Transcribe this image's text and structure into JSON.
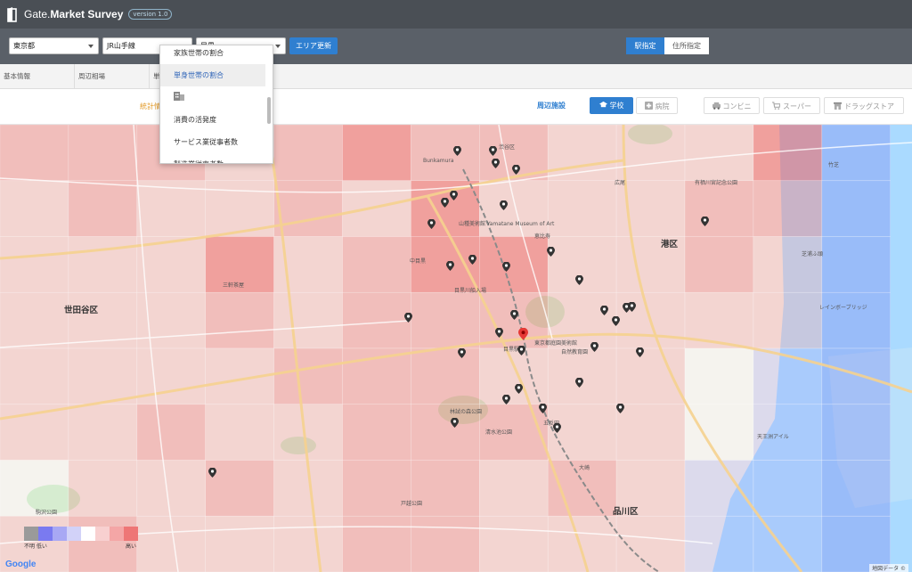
{
  "header": {
    "brand_prefix": "Gate.",
    "brand_main": "Market Survey",
    "version": "version 1.0"
  },
  "toolbar": {
    "prefecture": "東京都",
    "line": "JR山手線",
    "station": "目黒",
    "update_button": "エリア更新",
    "mode_station": "駅指定",
    "mode_address": "住所指定"
  },
  "tabs": [
    "基本情報",
    "周辺相場",
    "単"
  ],
  "filter": {
    "stats_link": "統計情",
    "facility_label": "周辺施設",
    "buttons": [
      {
        "label": "学校",
        "icon": "school-icon",
        "active": true
      },
      {
        "label": "病院",
        "icon": "hospital-icon",
        "active": false
      },
      {
        "label": "コンビニ",
        "icon": "car-icon",
        "active": false
      },
      {
        "label": "スーパー",
        "icon": "cart-icon",
        "active": false
      },
      {
        "label": "ドラッグストア",
        "icon": "store-icon",
        "active": false
      }
    ]
  },
  "dropdown": {
    "items": [
      "家族世帯の割合",
      "単身世帯の割合",
      "",
      "消費の活発度",
      "サービス業従事者数",
      "製造業従事者数"
    ],
    "selected_index": 1
  },
  "map": {
    "wards": [
      {
        "name": "世田谷区"
      },
      {
        "name": "港区"
      },
      {
        "name": "品川区"
      }
    ],
    "places": [
      "Bunkamura",
      "山種美術館 Yamatane Museum of Art",
      "目黒川船入場",
      "渋谷区",
      "東京都庭園美術館",
      "目黒駅",
      "広尾",
      "恵比寿",
      "中目黒",
      "三軒茶屋",
      "五反田",
      "大崎",
      "戸越公園",
      "清水池公園",
      "駒沢公園",
      "林試の森公園",
      "自然教育園",
      "有栖川宮記念公園",
      "芝浦ふ頭",
      "レインボーブリッジ",
      "竹芝",
      "天王洲アイル"
    ],
    "attribution": "地図データ ©",
    "google": "Google"
  },
  "legend": {
    "low_label": "不明 低い",
    "high_label": "高い"
  }
}
